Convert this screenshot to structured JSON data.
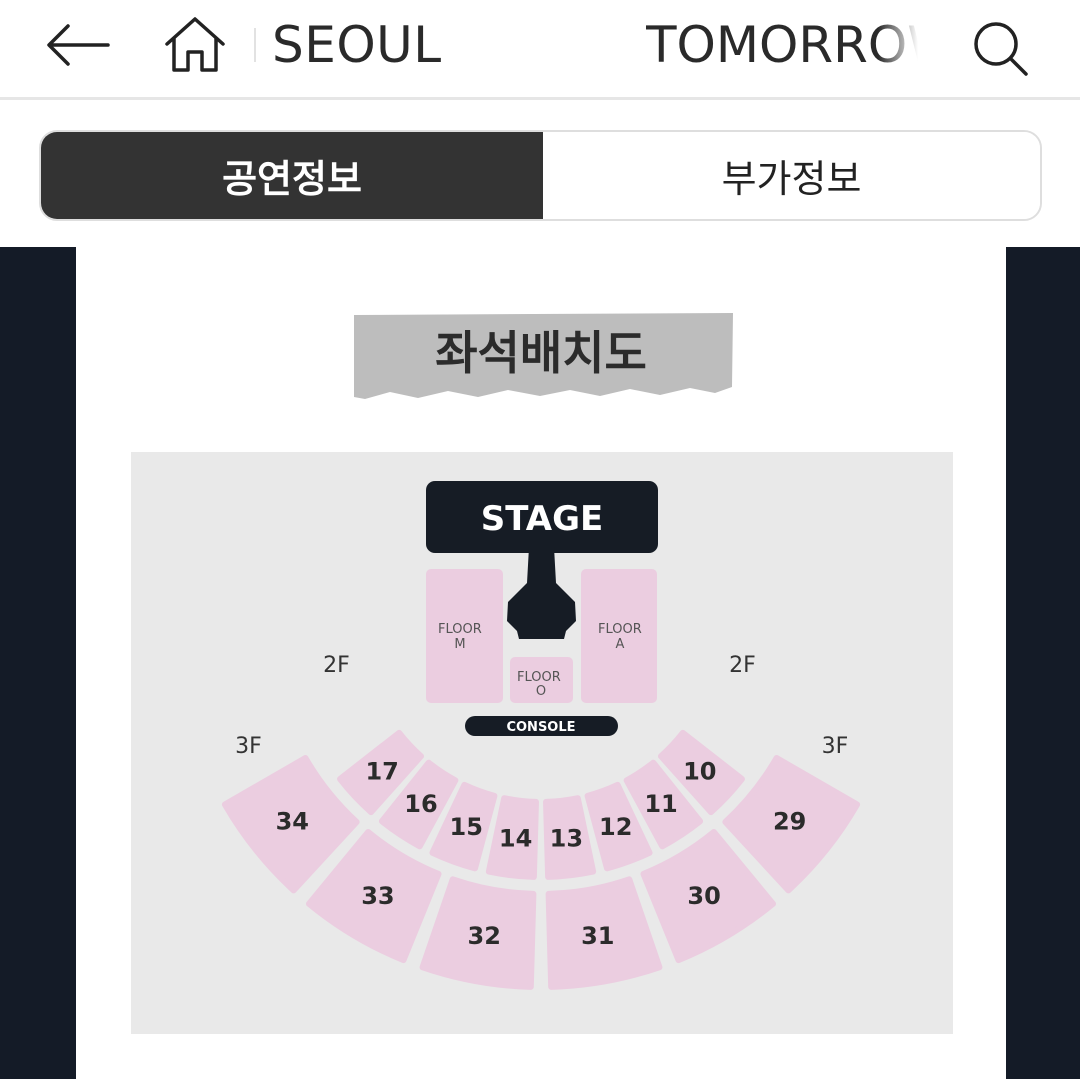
{
  "header": {
    "city": "SEOUL",
    "tour_name": "TOMORROW"
  },
  "tabs": [
    {
      "label": "공연정보",
      "active": true
    },
    {
      "label": "부가정보",
      "active": false
    }
  ],
  "seat_map": {
    "title": "좌석배치도",
    "stage_label": "STAGE",
    "console_label": "CONSOLE",
    "floor_m": {
      "line1": "FLOOR",
      "line2": "M"
    },
    "floor_a": {
      "line1": "FLOOR",
      "line2": "A"
    },
    "floor_o": {
      "line1": "FLOOR",
      "line2": "O"
    },
    "level_labels": {
      "left_2f": "2F",
      "right_2f": "2F",
      "left_3f": "3F",
      "right_3f": "3F"
    },
    "sections_2f": [
      "17",
      "16",
      "15",
      "14",
      "13",
      "12",
      "11",
      "10"
    ],
    "sections_3f": [
      "34",
      "33",
      "32",
      "31",
      "30",
      "29"
    ],
    "colors": {
      "section": "#ebcde0",
      "map_background": "#e9e9e9",
      "stage": "#161c25",
      "side_panels": "#141b27",
      "title_ribbon": "#bdbdbd"
    }
  }
}
